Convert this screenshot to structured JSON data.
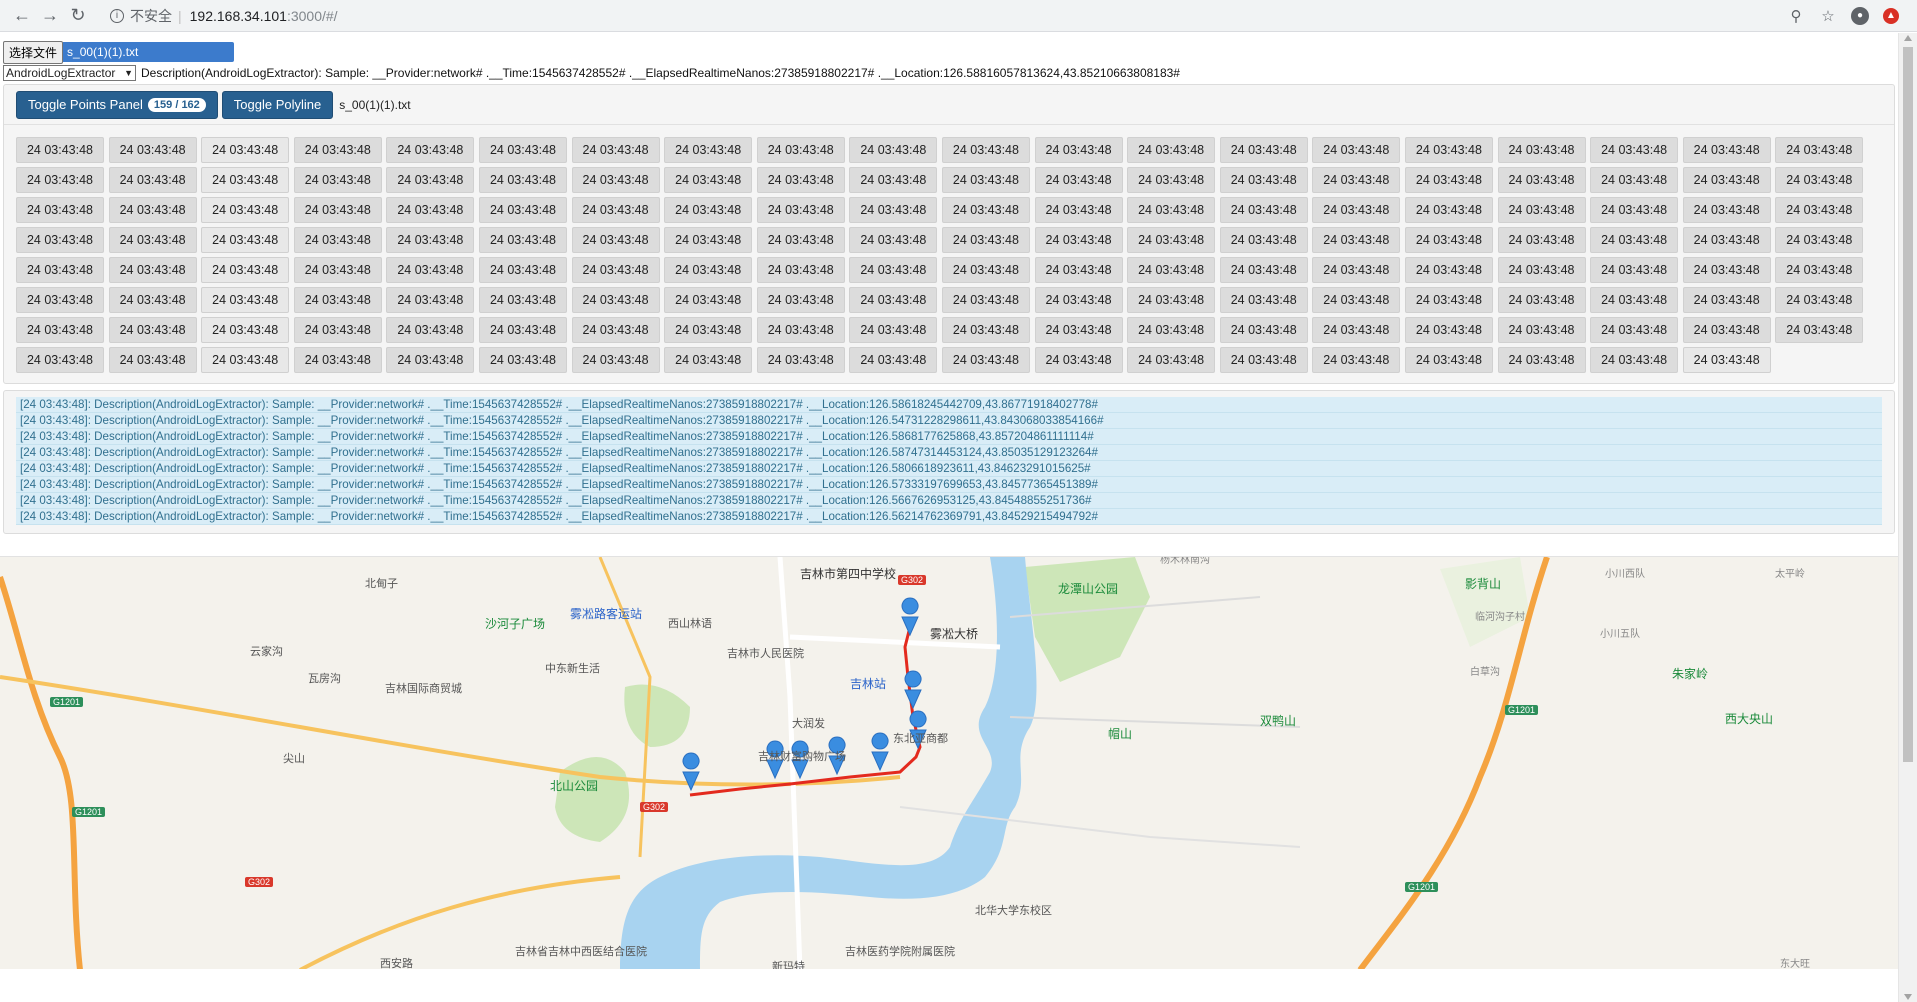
{
  "browser": {
    "security_text": "不安全",
    "url_host": "192.168.34.101",
    "url_path": ":3000/#/"
  },
  "upload": {
    "button_label": "选择文件",
    "file_name": "s_00(1)(1).txt"
  },
  "extractor": {
    "selected": "AndroidLogExtractor",
    "description": "Description(AndroidLogExtractor): Sample: __Provider:network# .__Time:1545637428552# .__ElapsedRealtimeNanos:27385918802217# .__Location:126.58816057813624,43.85210663808183#"
  },
  "toolbar": {
    "toggle_points_label": "Toggle Points Panel",
    "points_badge": "159 / 162",
    "toggle_polyline_label": "Toggle Polyline",
    "file_name": "s_00(1)(1).txt"
  },
  "points": {
    "cell_label": "24 03:43:48",
    "count": 159
  },
  "logs": [
    "[24 03:43:48]: Description(AndroidLogExtractor): Sample: __Provider:network# .__Time:1545637428552# .__ElapsedRealtimeNanos:27385918802217# .__Location:126.58618245442709,43.86771918402778#",
    "[24 03:43:48]: Description(AndroidLogExtractor): Sample: __Provider:network# .__Time:1545637428552# .__ElapsedRealtimeNanos:27385918802217# .__Location:126.54731228298611,43.843068033854166#",
    "[24 03:43:48]: Description(AndroidLogExtractor): Sample: __Provider:network# .__Time:1545637428552# .__ElapsedRealtimeNanos:27385918802217# .__Location:126.5868177625868,43.857204861111114#",
    "[24 03:43:48]: Description(AndroidLogExtractor): Sample: __Provider:network# .__Time:1545637428552# .__ElapsedRealtimeNanos:27385918802217# .__Location:126.58747314453124,43.85035129123264#",
    "[24 03:43:48]: Description(AndroidLogExtractor): Sample: __Provider:network# .__Time:1545637428552# .__ElapsedRealtimeNanos:27385918802217# .__Location:126.5806618923611,43.84623291015625#",
    "[24 03:43:48]: Description(AndroidLogExtractor): Sample: __Provider:network# .__Time:1545637428552# .__ElapsedRealtimeNanos:27385918802217# .__Location:126.57333197699653,43.84577365451389#",
    "[24 03:43:48]: Description(AndroidLogExtractor): Sample: __Provider:network# .__Time:1545637428552# .__ElapsedRealtimeNanos:27385918802217# .__Location:126.5667626953125,43.84548855251736#",
    "[24 03:43:48]: Description(AndroidLogExtractor): Sample: __Provider:network# .__Time:1545637428552# .__ElapsedRealtimeNanos:27385918802217# .__Location:126.56214762369791,43.84529215494792#"
  ],
  "map": {
    "labels": [
      "吉林市第四中学校",
      "龙潭山公园",
      "杨木林南沟",
      "影背山",
      "小川西队",
      "太平岭",
      "北甸子",
      "雾凇路客运站",
      "西山林语",
      "沙河子广场",
      "雾凇大桥",
      "临河沟子村",
      "吉林市人民医院",
      "中东新生活",
      "吉林国际商贸城",
      "吉林站",
      "云家沟",
      "瓦房沟",
      "小川五队",
      "朱家岭",
      "白草沟",
      "大润发",
      "吉林财富购物广场",
      "东北亚商都",
      "帽山",
      "双鸭山",
      "西大央山",
      "北山公园",
      "尖山",
      "北华大学东校区",
      "吉林省吉林中西医结合医院",
      "吉林医药学院附属医院",
      "新玛特",
      "西安路",
      "东大旺"
    ],
    "road_badges": [
      "G302",
      "G1201",
      "G1201",
      "G302",
      "G1201",
      "G302",
      "G1201"
    ],
    "marker_count": 8
  }
}
